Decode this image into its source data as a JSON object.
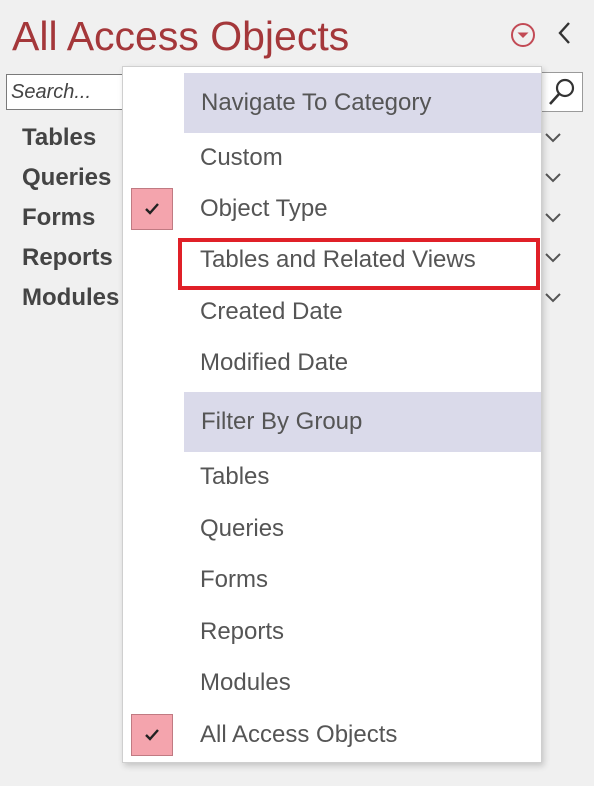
{
  "pane": {
    "title": "All Access Objects",
    "search_placeholder": "Search...",
    "groups": [
      "Tables",
      "Queries",
      "Forms",
      "Reports",
      "Modules"
    ]
  },
  "menu": {
    "headers": {
      "navigate": "Navigate To Category",
      "filter": "Filter By Group"
    },
    "navigate_items": [
      {
        "label": "Custom",
        "checked": false
      },
      {
        "label": "Object Type",
        "checked": true
      },
      {
        "label": "Tables and Related Views",
        "checked": false,
        "highlighted": true
      },
      {
        "label": "Created Date",
        "checked": false
      },
      {
        "label": "Modified Date",
        "checked": false
      }
    ],
    "filter_items": [
      {
        "label": "Tables",
        "checked": false
      },
      {
        "label": "Queries",
        "checked": false
      },
      {
        "label": "Forms",
        "checked": false
      },
      {
        "label": "Reports",
        "checked": false
      },
      {
        "label": "Modules",
        "checked": false
      },
      {
        "label": "All Access Objects",
        "checked": true
      }
    ]
  },
  "colors": {
    "title": "#a4373a",
    "header_bg": "#dadaea",
    "check_bg": "#f4a4ad",
    "highlight": "#e02028"
  },
  "icons": {
    "dropdown": "circle-chevron-down-icon",
    "collapse": "chevron-left-icon",
    "search": "magnifier-icon",
    "group_expand": "chevron-down-icon",
    "check": "checkmark-icon"
  }
}
